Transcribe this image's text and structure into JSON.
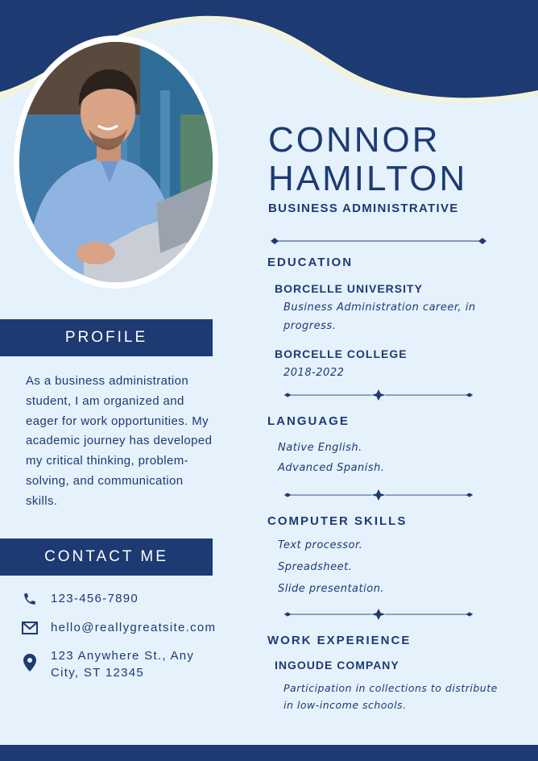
{
  "person": {
    "first_name": "CONNOR",
    "last_name": "HAMILTON",
    "title": "BUSINESS ADMINISTRATIVE"
  },
  "profile": {
    "heading": "PROFILE",
    "text": "As a business administration student, I am organized and eager for work opportunities. My academic journey has developed my critical thinking, problem-solving, and communication skills."
  },
  "contact": {
    "heading": "CONTACT ME",
    "phone": "123-456-7890",
    "email": "hello@reallygreatsite.com",
    "address": "123 Anywhere St., Any City, ST 12345",
    "icons": [
      "phone-icon",
      "envelope-icon",
      "location-pin-icon"
    ]
  },
  "education": {
    "heading": "EDUCATION",
    "items": [
      {
        "institution": "BORCELLE UNIVERSITY",
        "detail": "Business Administration career, in progress."
      },
      {
        "institution": "BORCELLE COLLEGE",
        "detail": "2018-2022"
      }
    ]
  },
  "language": {
    "heading": "LANGUAGE",
    "items": [
      "Native English.",
      "Advanced Spanish."
    ]
  },
  "computer_skills": {
    "heading": "COMPUTER SKILLS",
    "items": [
      "Text processor.",
      "Spreadsheet.",
      "Slide presentation."
    ]
  },
  "work_experience": {
    "heading": "WORK EXPERIENCE",
    "company": "INGOUDE COMPANY",
    "detail": "Participation in collections to distribute in low-income schools."
  },
  "colors": {
    "navy": "#1d3a72",
    "background": "#e5f1fb",
    "wave_highlight": "#f3f3dd",
    "white": "#ffffff"
  }
}
